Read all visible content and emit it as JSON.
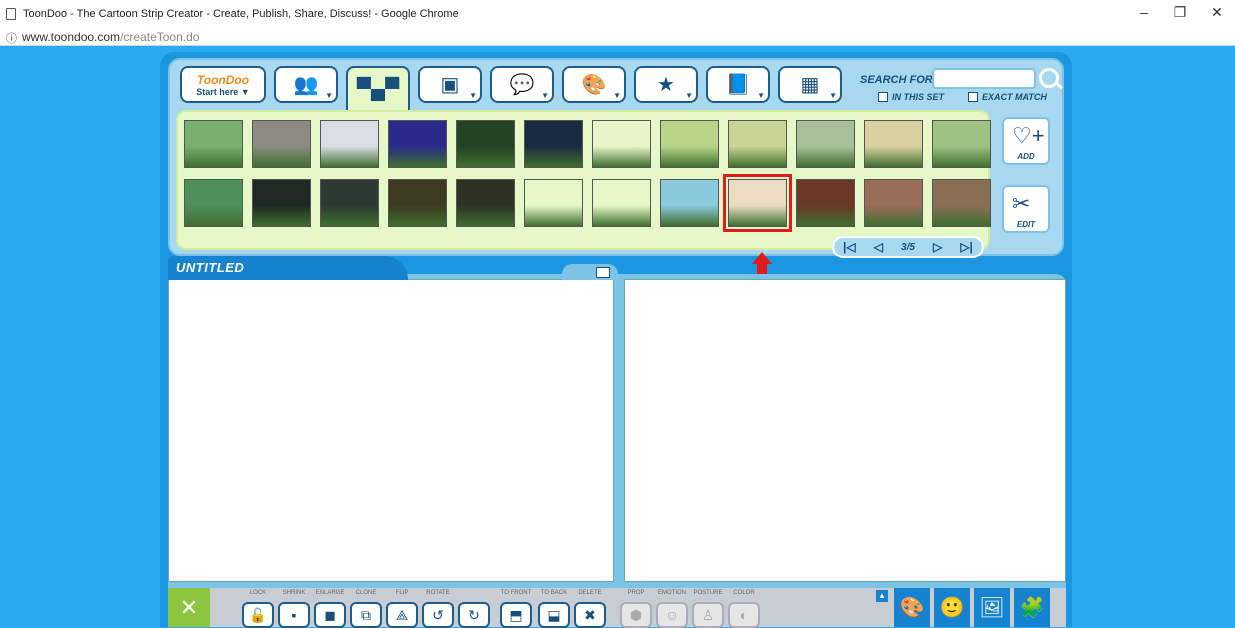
{
  "window": {
    "title": "ToonDoo - The Cartoon Strip Creator - Create, Publish, Share, Discuss! - Google Chrome",
    "controls": [
      "–",
      "❐",
      "✕"
    ]
  },
  "address": {
    "info_icon": "info-icon",
    "domain": "www.toondoo.com",
    "path": "/createToon.do"
  },
  "tabs": [
    {
      "name": "start-here",
      "logo": "ToonDoo",
      "label": "Start here ▼"
    },
    {
      "name": "characters",
      "icon": "people-icon",
      "glyph": "👥"
    },
    {
      "name": "backgrounds",
      "icon": "skyline-icon",
      "glyph": "▀▄▀"
    },
    {
      "name": "props",
      "icon": "box-icon",
      "glyph": "▣"
    },
    {
      "name": "speech",
      "icon": "speech-bubble-icon",
      "glyph": "💬"
    },
    {
      "name": "scenes",
      "icon": "easel-icon",
      "glyph": "🎨"
    },
    {
      "name": "special",
      "icon": "stars-icon",
      "glyph": "★"
    },
    {
      "name": "books",
      "icon": "book-icon",
      "glyph": "📘"
    },
    {
      "name": "layouts",
      "icon": "layout-icon",
      "glyph": "▦"
    }
  ],
  "search": {
    "label": "SEARCH FOR",
    "value": "",
    "in_this_set": "IN THIS SET",
    "exact_match": "EXACT MATCH"
  },
  "thumbnails_row1": [
    "#79b06d",
    "#8b8b84",
    "#d9dde6",
    "#2a2a8a",
    "#234323",
    "#1b2b3f",
    "#e8f5c8",
    "#b9d489",
    "#c9d594",
    "#a7c09a",
    "#d8d0a0",
    "#9fc184"
  ],
  "thumbnails_row2": [
    "#4e8f5c",
    "#1e2a23",
    "#2c3a33",
    "#3c3a20",
    "#2e3223",
    "#e7f8c8",
    "#e7f8c8",
    "#8bc9dd",
    "#ecdcc4",
    "#6b3826",
    "#9a6c5a",
    "#8b6f55"
  ],
  "selected_index": 8,
  "side_buttons": {
    "add": "ADD",
    "edit": "EDIT"
  },
  "pager": {
    "first": "|◁",
    "prev": "◁",
    "page": "3/5",
    "next": "▷",
    "last": "▷|"
  },
  "strip_title": "UNTITLED",
  "toolbar": {
    "tools": [
      {
        "label": "LOCK",
        "glyph": "🔓",
        "enabled": true
      },
      {
        "label": "SHRINK",
        "glyph": "▪",
        "enabled": true
      },
      {
        "label": "ENLARGE",
        "glyph": "◼",
        "enabled": true
      },
      {
        "label": "CLONE",
        "glyph": "⧉",
        "enabled": true
      },
      {
        "label": "FLIP",
        "glyph": "⟁",
        "enabled": true
      },
      {
        "label": "ROTATE",
        "glyph": "↺",
        "enabled": true
      },
      {
        "label": "",
        "glyph": "↻",
        "enabled": true
      },
      {
        "label": "TO FRONT",
        "glyph": "⬒",
        "enabled": true
      },
      {
        "label": "TO BACK",
        "glyph": "⬓",
        "enabled": true
      },
      {
        "label": "DELETE",
        "glyph": "✖",
        "enabled": true
      },
      {
        "label": "PROP",
        "glyph": "⬢",
        "enabled": false
      },
      {
        "label": "EMOTION",
        "glyph": "☺",
        "enabled": false
      },
      {
        "label": "POSTURE",
        "glyph": "♙",
        "enabled": false
      },
      {
        "label": "COLOR",
        "glyph": "◐",
        "enabled": false
      }
    ],
    "right": [
      "🎨",
      "🙂",
      "🖼",
      "🧩"
    ]
  }
}
